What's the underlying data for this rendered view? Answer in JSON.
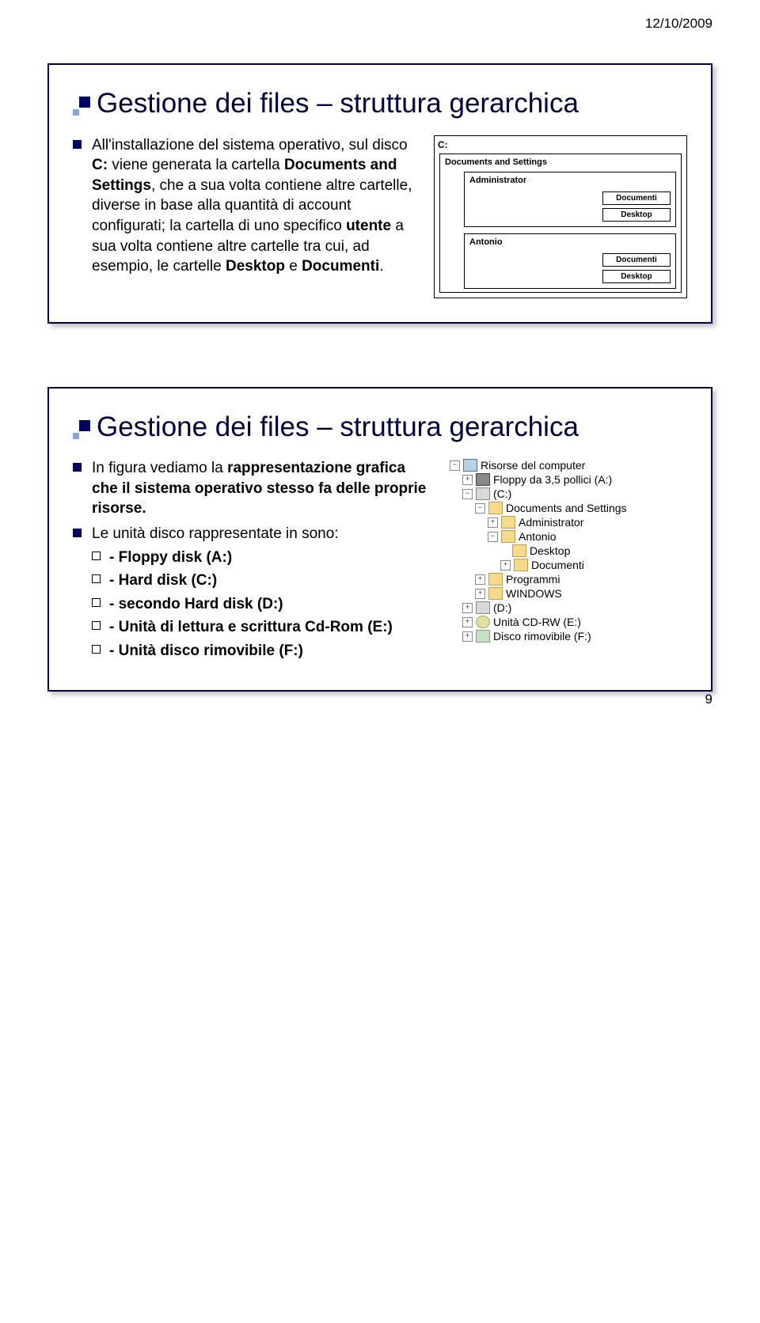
{
  "header": {
    "date": "12/10/2009",
    "page_number": "9"
  },
  "slide1": {
    "title": "Gestione dei files – struttura gerarchica",
    "bullet_prefix": "All'installazione del sistema operativo, sul disco ",
    "c_drive": "C:",
    "bullet_mid1": " viene generata la cartella ",
    "docs_settings": "Documents and Settings",
    "bullet_mid2": ", che a sua volta contiene altre cartelle, diverse in base alla quantità di account configurati; la cartella di uno specifico ",
    "utente": "utente",
    "bullet_mid3": " a sua volta contiene altre cartelle tra cui, ad esempio, le cartelle ",
    "desktop": "Desktop",
    "e": " e ",
    "documenti": "Documenti",
    "dot": ".",
    "diagram": {
      "root": "C:",
      "docs": "Documents and Settings",
      "admin": "Administrator",
      "antonio": "Antonio",
      "child1": "Documenti",
      "child2": "Desktop"
    }
  },
  "slide2": {
    "title": "Gestione dei files – struttura gerarchica",
    "b1_pre": "In figura vediamo la ",
    "b1_bold": "rappresentazione grafica che il sistema operativo stesso fa delle proprie risorse.",
    "b2": "Le unità disco rappresentate in sono:",
    "subs": {
      "s1": "- Floppy disk (A:)",
      "s2": "- Hard disk (C:)",
      "s3": "- secondo Hard disk (D:)",
      "s4": "- Unità di lettura e scrittura Cd-Rom (E:)",
      "s5": "- Unità disco rimovibile (F:)"
    },
    "tree": {
      "root": "Risorse del computer",
      "floppy": "Floppy da 3,5 pollici (A:)",
      "c": "(C:)",
      "docs": "Documents and Settings",
      "admin": "Administrator",
      "antonio": "Antonio",
      "desktop": "Desktop",
      "documenti": "Documenti",
      "programmi": "Programmi",
      "windows": "WINDOWS",
      "d": "(D:)",
      "cd": "Unità CD-RW (E:)",
      "usb": "Disco rimovibile (F:)"
    }
  }
}
